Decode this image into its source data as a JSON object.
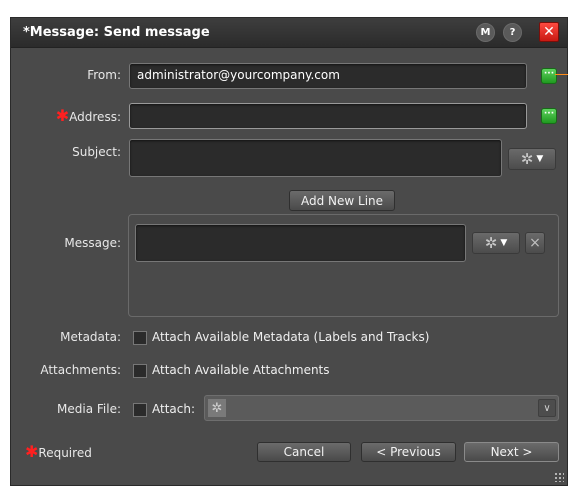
{
  "window": {
    "title": "*Message: Send message",
    "buttons": {
      "m": "M",
      "help": "?",
      "close": "✕"
    }
  },
  "form": {
    "from": {
      "label": "From:",
      "value": "administrator@yourcompany.com"
    },
    "address": {
      "label": "Address:",
      "value": ""
    },
    "subject": {
      "label": "Subject:",
      "value": ""
    },
    "add_new_line": "Add New Line",
    "message": {
      "label": "Message:",
      "value": ""
    },
    "metadata": {
      "label": "Metadata:",
      "checkbox_label": "Attach Available Metadata (Labels and Tracks)",
      "checked": false
    },
    "attachments": {
      "label": "Attachments:",
      "checkbox_label": "Attach Available Attachments",
      "checked": false
    },
    "media_file": {
      "label": "Media File:",
      "checkbox_label": "Attach:",
      "checked": false,
      "selected": ""
    }
  },
  "footer": {
    "required": "Required",
    "cancel": "Cancel",
    "previous": "< Previous",
    "next": "Next >"
  },
  "icons": {
    "green_button": "ellipsis-icon",
    "gear": "gear-icon",
    "chevron": "chevron-down-icon",
    "remove": "close-icon",
    "required_star": "asterisk-icon"
  },
  "colors": {
    "accent_green": "#1f9a1f",
    "close_red": "#c81912",
    "required_red": "#ff2020",
    "connector_orange": "#ff8c1a"
  }
}
